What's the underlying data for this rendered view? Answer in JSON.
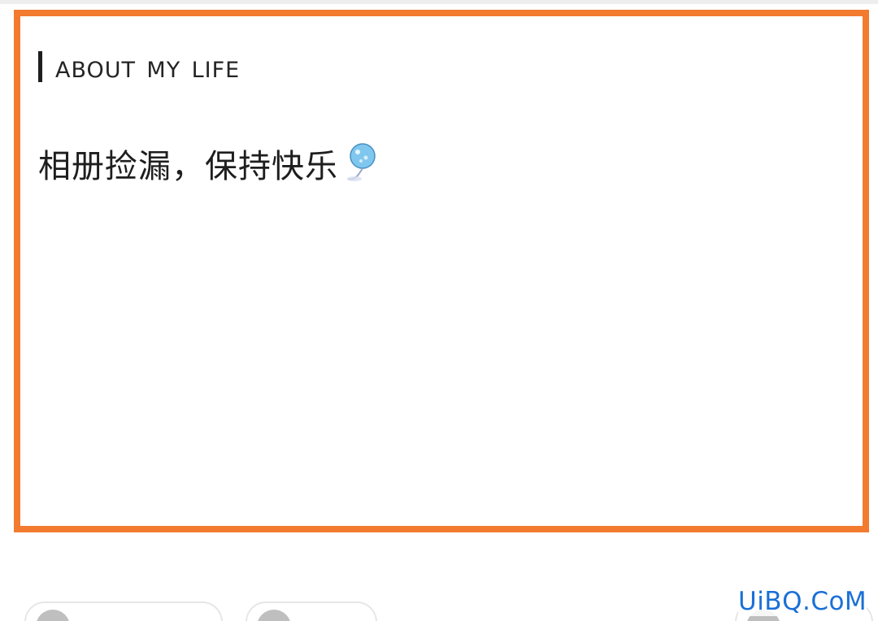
{
  "post": {
    "heading": "about my life",
    "caption": "相册捡漏，保持快乐"
  },
  "icons": {
    "balloon": "balloon-icon",
    "avatar": "avatar-icon"
  },
  "bottom_bar": {
    "dots": "• •"
  },
  "watermark": {
    "text": "UiBQ.CoM"
  },
  "colors": {
    "frame": "#f27b2f",
    "watermark": "#1a6fd6"
  }
}
